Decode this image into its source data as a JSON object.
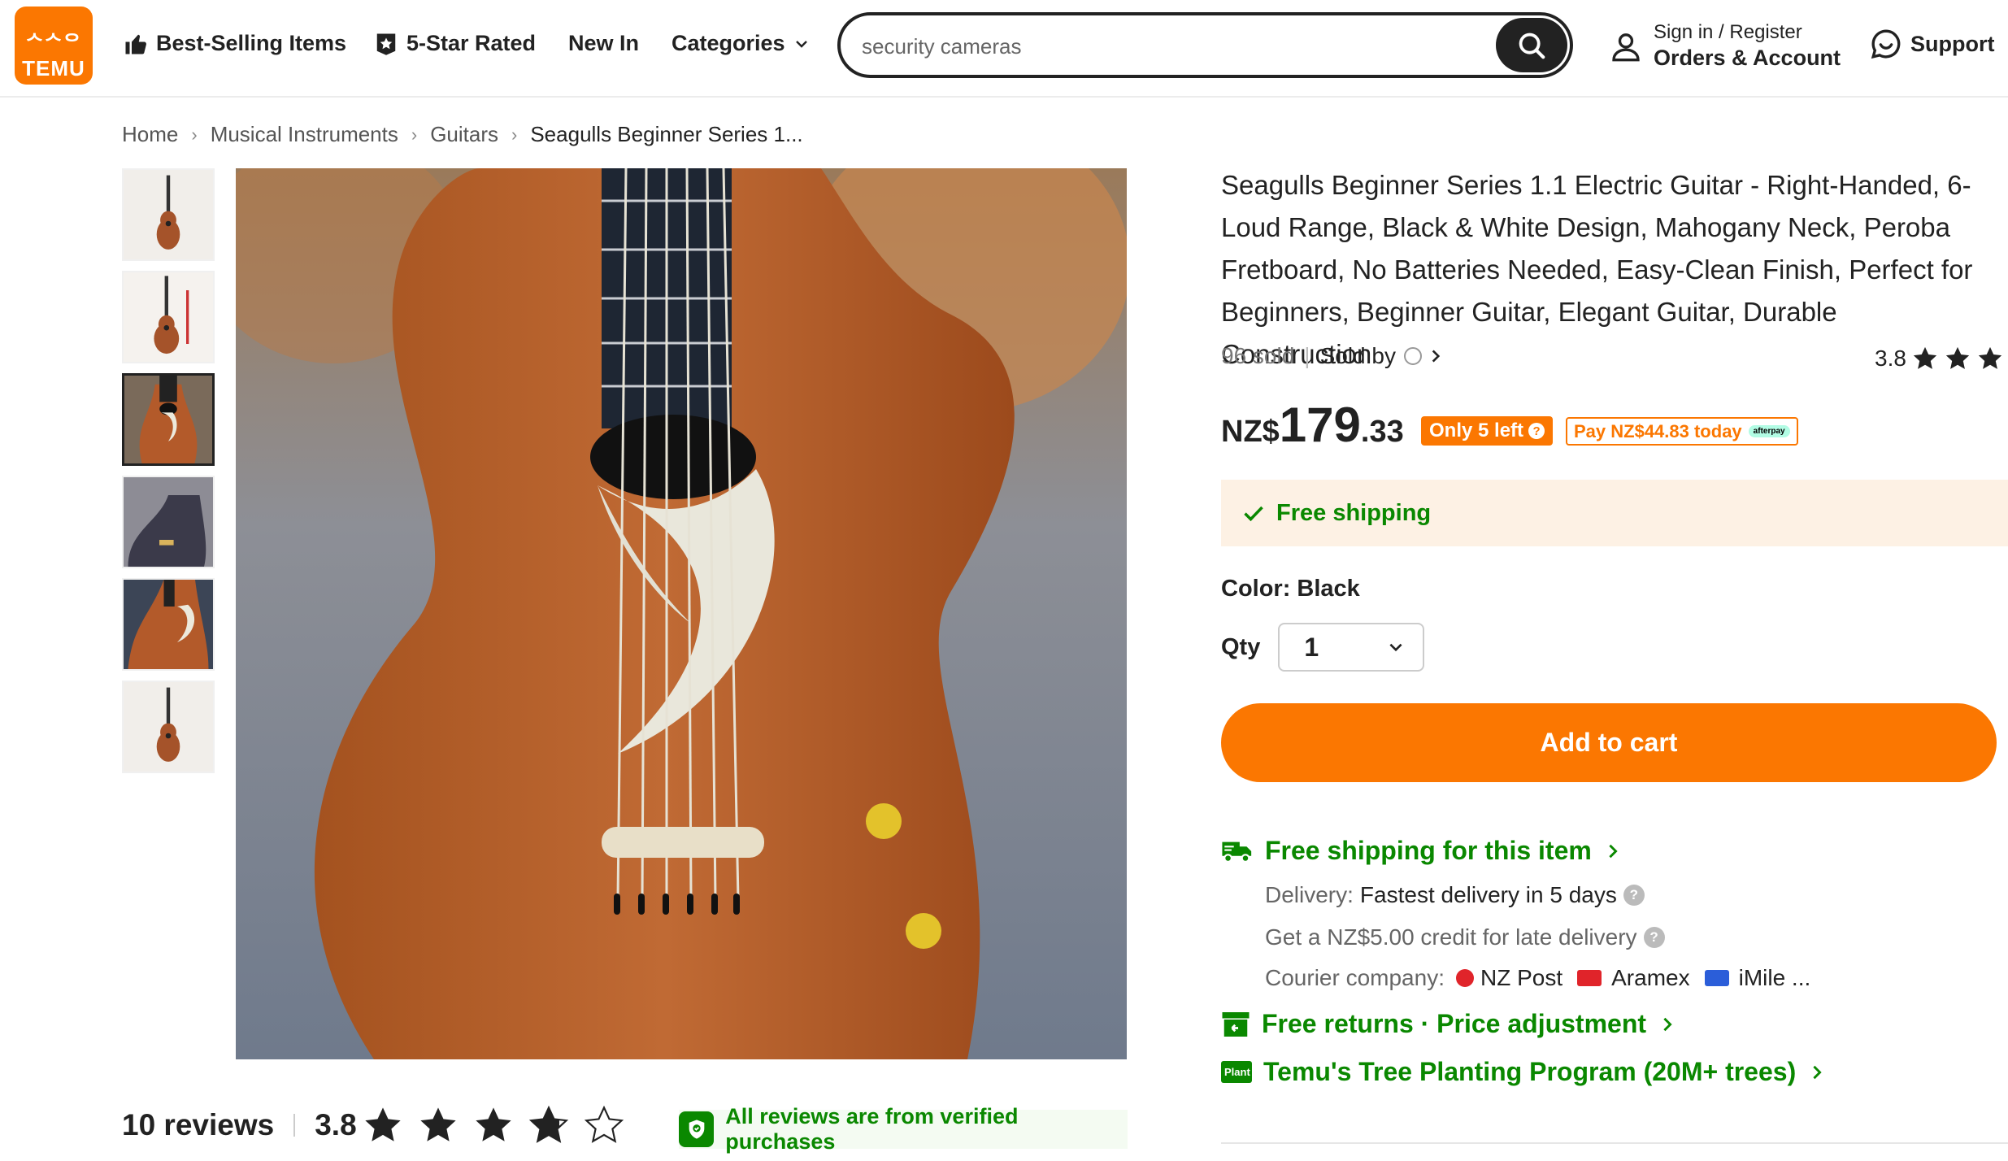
{
  "header": {
    "logo_line1": "ᄉᄉᄋ",
    "logo_line2": "TEMU",
    "nav": {
      "best_selling": "Best-Selling Items",
      "five_star": "5-Star Rated",
      "new_in": "New In",
      "categories": "Categories"
    },
    "search": {
      "value": "security cameras"
    },
    "signin": {
      "line1": "Sign in / Register",
      "line2": "Orders & Account"
    },
    "support": "Support"
  },
  "breadcrumb": {
    "home": "Home",
    "cat1": "Musical Instruments",
    "cat2": "Guitars",
    "current": "Seagulls Beginner Series 1..."
  },
  "gallery": {
    "thumbnail_count": 6,
    "active_index": 2
  },
  "product": {
    "title": "Seagulls Beginner Series 1.1 Electric Guitar - Right-Handed, 6-Loud Range, Black & White Design, Mahogany Neck, Peroba Fretboard, No Batteries Needed, Easy-Clean Finish, Perfect for Beginners, Beginner Guitar, Elegant Guitar, Durable Construction",
    "sold": "96 sold",
    "sold_by": "Sold by",
    "rating": "3.8",
    "price": {
      "currency": "NZ$",
      "whole": "179",
      "cents": ".33"
    },
    "stock_badge": "Only 5 left",
    "pay_today": "Pay NZ$44.83 today",
    "afterpay_label": "afterpay",
    "free_shipping_banner": "Free shipping",
    "color_label": "Color: Black",
    "qty_label": "Qty",
    "qty_value": "1",
    "add_to_cart": "Add to cart"
  },
  "shipping": {
    "free_shipping_link": "Free shipping for this item",
    "delivery_label": "Delivery:",
    "delivery_value": "Fastest delivery in 5 days",
    "credit_text": "Get a NZ$5.00 credit for late delivery",
    "courier_label": "Courier company:",
    "courier1": "NZ Post",
    "courier2": "Aramex",
    "courier3": "iMile ...",
    "returns_link": "Free returns · Price adjustment",
    "tree_badge": "Plant",
    "tree_link": "Temu's Tree Planting Program (20M+ trees)"
  },
  "reviews": {
    "count": "10 reviews",
    "score": "3.8",
    "stars_filled": 3.8,
    "verified": "All reviews are from verified purchases"
  },
  "colors": {
    "brand_orange": "#fb7701",
    "green": "#0a8800",
    "dark": "#222222"
  }
}
